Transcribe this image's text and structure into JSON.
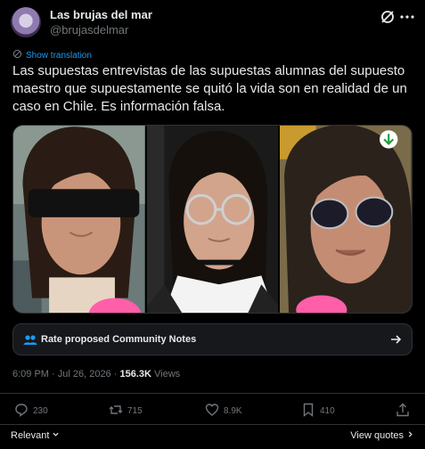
{
  "tweet": {
    "author": {
      "name": "Las brujas del mar",
      "handle": "@brujasdelmar"
    },
    "show_translation": "Show translation",
    "text": "Las supuestas entrevistas de las supuestas alumnas del supuesto maestro que supuestamente se quitó la vida son en realidad de un caso en Chile. Es información falsa.",
    "community_notes_label": "Rate proposed Community Notes",
    "time": "6:09 PM · Jul 26, 2026 · ",
    "views_count": "156.3K",
    "views_label": "Views",
    "stats": {
      "replies": "230",
      "reposts": "715",
      "likes": "8.9K",
      "bookmarks": "410"
    },
    "bottom": {
      "sort": "Relevant",
      "view_quotes": "View quotes"
    },
    "icons": [
      "grok-icon",
      "more-icon",
      "translate-icon",
      "community-notes-icon",
      "arrow-right-icon",
      "reply-icon",
      "repost-icon",
      "like-icon",
      "bookmark-icon",
      "share-icon",
      "chevron-down-icon",
      "chevron-right-icon",
      "download-icon"
    ],
    "colors": {
      "background": "#000000",
      "text": "#e7e9ea",
      "muted": "#71767b",
      "link": "#1d9bf0",
      "border": "#2f3336"
    }
  }
}
